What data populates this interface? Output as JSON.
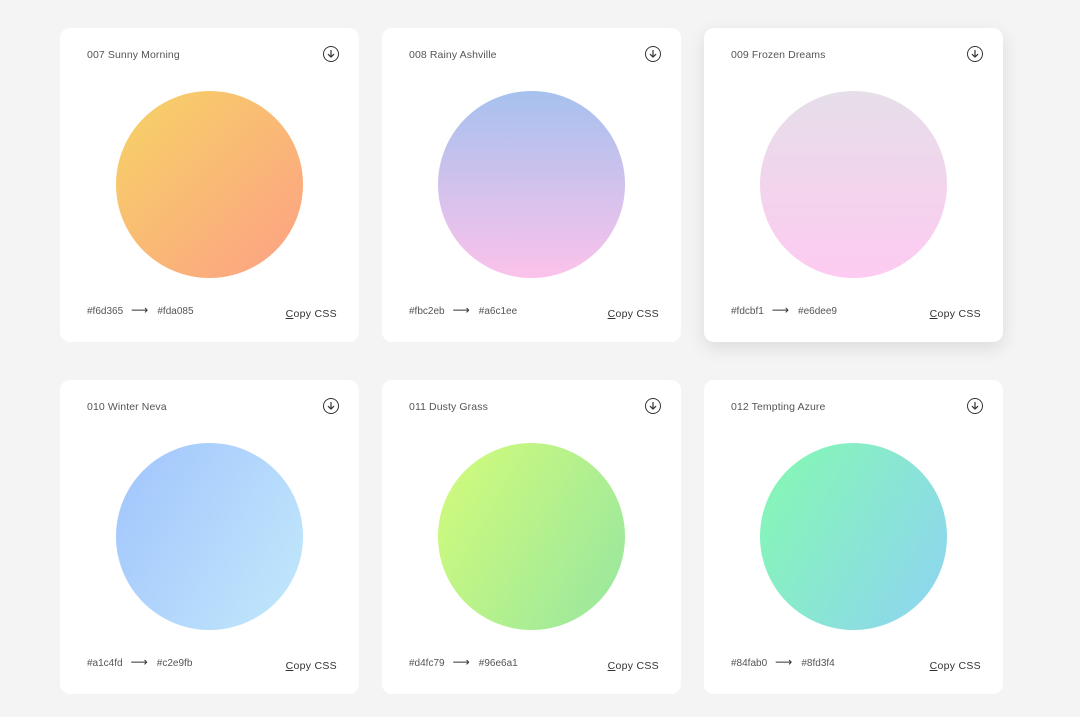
{
  "gradients": [
    {
      "title": "007 Sunny Morning",
      "from": "#f6d365",
      "to": "#fda085",
      "arrow": "⟶",
      "copy_label": "Copy CSS",
      "direction": "135deg"
    },
    {
      "title": "008 Rainy Ashville",
      "from": "#fbc2eb",
      "to": "#a6c1ee",
      "arrow": "⟶",
      "copy_label": "Copy CSS",
      "direction": "0deg"
    },
    {
      "title": "009 Frozen Dreams",
      "from": "#fdcbf1",
      "to": "#e6dee9",
      "arrow": "⟶",
      "copy_label": "Copy CSS",
      "direction": "0deg"
    },
    {
      "title": "010 Winter Neva",
      "from": "#a1c4fd",
      "to": "#c2e9fb",
      "arrow": "⟶",
      "copy_label": "Copy CSS",
      "direction": "120deg"
    },
    {
      "title": "011 Dusty Grass",
      "from": "#d4fc79",
      "to": "#96e6a1",
      "arrow": "⟶",
      "copy_label": "Copy CSS",
      "direction": "120deg"
    },
    {
      "title": "012 Tempting Azure",
      "from": "#84fab0",
      "to": "#8fd3f4",
      "arrow": "⟶",
      "copy_label": "Copy CSS",
      "direction": "120deg"
    }
  ]
}
